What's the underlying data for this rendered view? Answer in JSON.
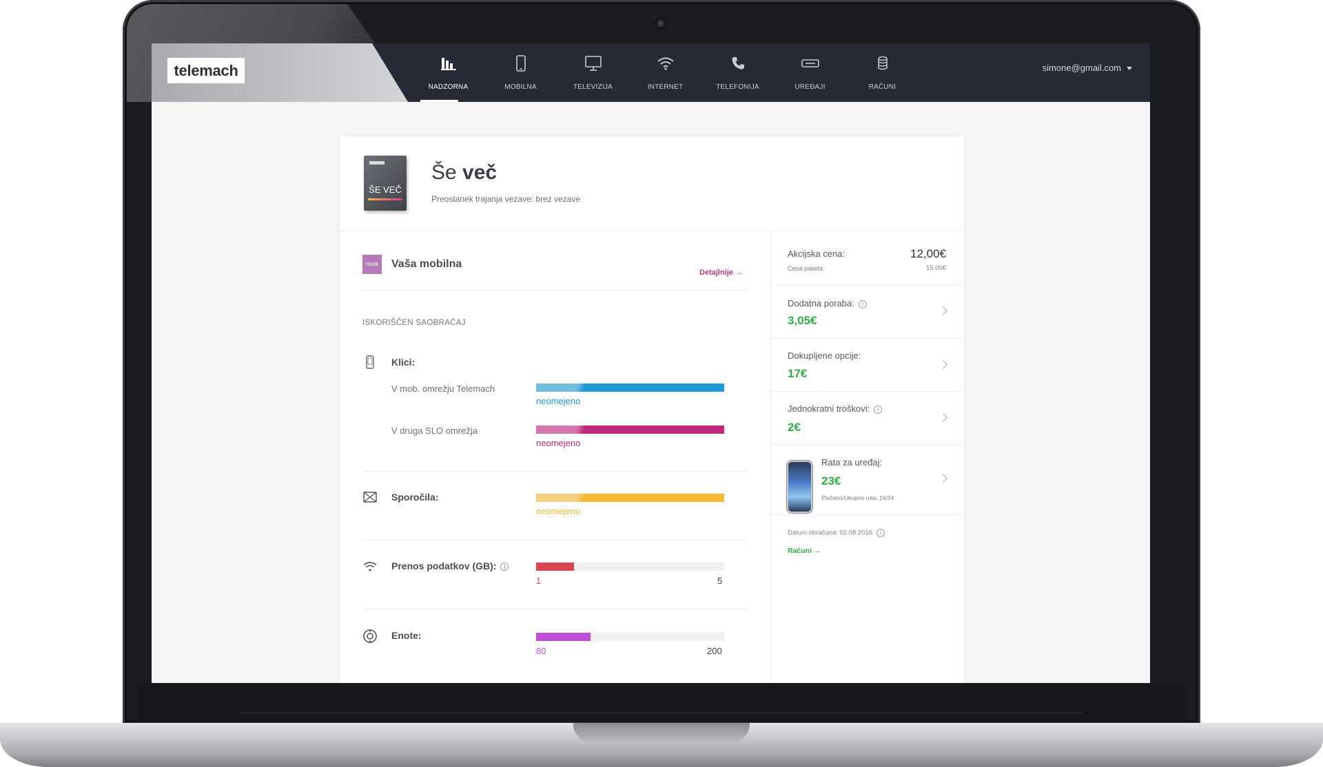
{
  "topbar": {
    "logo": "telemach",
    "nav": [
      {
        "label": "NADZORNA",
        "icon": "bar-chart-icon",
        "active": true
      },
      {
        "label": "MOBILNA",
        "icon": "mobile-phone-icon",
        "active": false
      },
      {
        "label": "TELEVIZIJA",
        "icon": "monitor-icon",
        "active": false
      },
      {
        "label": "INTERNET",
        "icon": "wifi-icon",
        "active": false
      },
      {
        "label": "TELEFONIJA",
        "icon": "phone-handset-icon",
        "active": false
      },
      {
        "label": "UREĐAJI",
        "icon": "device-icon",
        "active": false
      },
      {
        "label": "RAČUNI",
        "icon": "coins-icon",
        "active": false
      }
    ],
    "user_email": "simone@gmail.com"
  },
  "package": {
    "box_label": "ŠE VEČ",
    "title_light": "Še",
    "title_bold": "več",
    "subtitle": "Preostanek trajanja vezave: brez vezave"
  },
  "mobile": {
    "badge": "mobi",
    "title": "Vaša mobilna",
    "details_link": "Detajlnije →",
    "section_label": "ISKORIŠČEN SAOBRAĆAJ",
    "calls": {
      "title": "Klici:",
      "items": [
        {
          "label": "V mob. omrežju Telemach",
          "value_text": "neomejeno",
          "fraction": 1.0,
          "color": "#1e9ad6"
        },
        {
          "label": "V druga SLO omrežja",
          "value_text": "neomejeno",
          "fraction": 1.0,
          "color": "#c0287a"
        }
      ]
    },
    "sms": {
      "title": "Sporočila:",
      "value_text": "neomejeno",
      "fraction": 1.0,
      "color": "#f5b935"
    },
    "data": {
      "title": "Prenos podatkov (GB):",
      "used": "1",
      "total": "5",
      "fraction": 0.2,
      "color": "#d9464f"
    },
    "units": {
      "title": "Enote:",
      "used": "80",
      "total": "200",
      "fraction": 0.29,
      "color": "#c04fd6"
    }
  },
  "summary": {
    "promo_price_label": "Akcijska cena:",
    "promo_price": "12,00€",
    "package_price_label": "Cena paketa:",
    "package_price": "15,00€",
    "extra_usage_label": "Dodatna poraba:",
    "extra_usage": "3,05€",
    "options_label": "Dokupljene opcije:",
    "options": "17€",
    "one_time_label": "Jednokratni troškovi:",
    "one_time": "2€",
    "device_label": "Rata za uređaj:",
    "device": "23€",
    "device_installments": "Plačeno/Ukupno rata: 16/24",
    "billing_date": "Datum obračuna: 02.08.2016",
    "bills_link": "Računi →"
  },
  "colors": {
    "accent": "#b8377d",
    "green": "#2fae43",
    "topbar": "#262a36"
  }
}
